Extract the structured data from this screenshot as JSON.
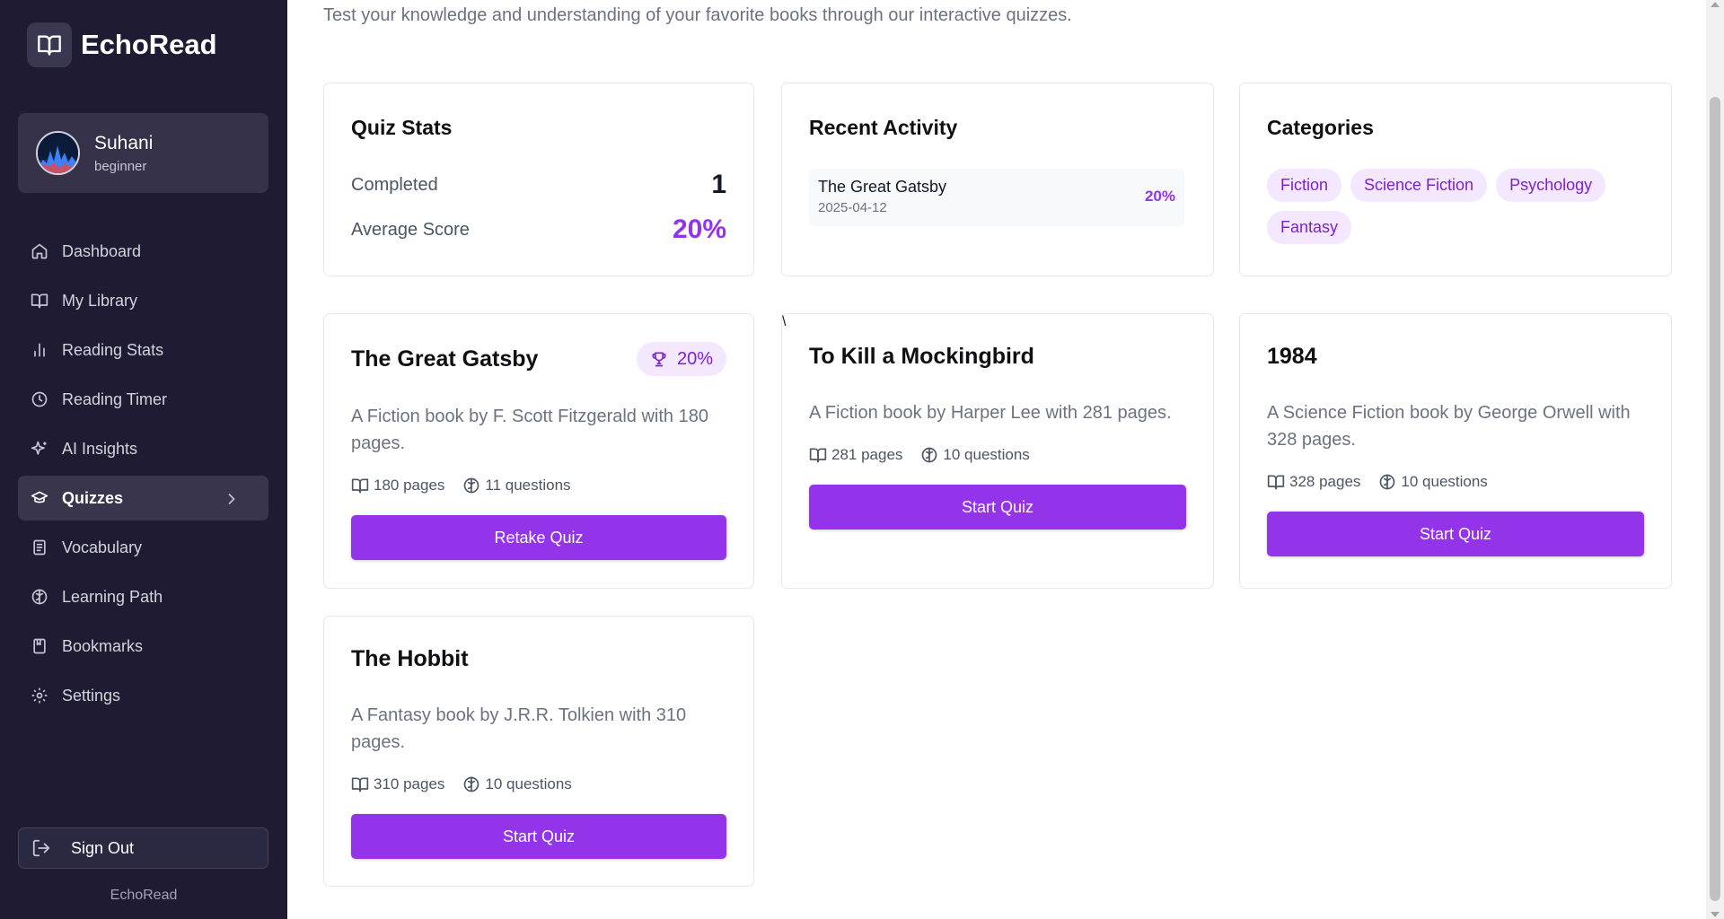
{
  "app": {
    "name": "EchoRead",
    "footer": "EchoRead"
  },
  "user": {
    "name": "Suhani",
    "level": "beginner"
  },
  "nav": [
    {
      "label": "Dashboard",
      "icon": "home-icon"
    },
    {
      "label": "My Library",
      "icon": "book-open-icon"
    },
    {
      "label": "Reading Stats",
      "icon": "bar-chart-icon"
    },
    {
      "label": "Reading Timer",
      "icon": "clock-icon"
    },
    {
      "label": "AI Insights",
      "icon": "sparkles-icon"
    },
    {
      "label": "Quizzes",
      "icon": "graduation-cap-icon",
      "active": true
    },
    {
      "label": "Vocabulary",
      "icon": "notebook-icon"
    },
    {
      "label": "Learning Path",
      "icon": "brain-icon"
    },
    {
      "label": "Bookmarks",
      "icon": "bookmark-book-icon"
    },
    {
      "label": "Settings",
      "icon": "gear-icon"
    }
  ],
  "sign_out": "Sign Out",
  "page": {
    "subtitle": "Test your knowledge and understanding of your favorite books through our interactive quizzes."
  },
  "quiz_stats": {
    "title": "Quiz Stats",
    "completed_label": "Completed",
    "completed_value": "1",
    "average_label": "Average Score",
    "average_value": "20%"
  },
  "recent_activity": {
    "title": "Recent Activity",
    "items": [
      {
        "book": "The Great Gatsby",
        "date": "2025-04-12",
        "score": "20%"
      }
    ]
  },
  "categories": {
    "title": "Categories",
    "tags": [
      "Fiction",
      "Science Fiction",
      "Psychology",
      "Fantasy"
    ]
  },
  "books": [
    {
      "title": "The Great Gatsby",
      "score": "20%",
      "description": "A Fiction book by F. Scott Fitzgerald with 180 pages.",
      "pages": "180 pages",
      "questions": "11 questions",
      "button": "Retake Quiz"
    },
    {
      "title": "To Kill a Mockingbird",
      "description": "A Fiction book by Harper Lee with 281 pages.",
      "pages": "281 pages",
      "questions": "10 questions",
      "button": "Start Quiz"
    },
    {
      "title": "1984",
      "description": "A Science Fiction book by George Orwell with 328 pages.",
      "pages": "328 pages",
      "questions": "10 questions",
      "button": "Start Quiz"
    },
    {
      "title": "The Hobbit",
      "description": "A Fantasy book by J.R.R. Tolkien with 310 pages.",
      "pages": "310 pages",
      "questions": "10 questions",
      "button": "Start Quiz"
    }
  ],
  "colors": {
    "sidebar": "#1e1b33",
    "accent": "#9333ea",
    "tag_bg": "#f3e8ff",
    "tag_text": "#7e22ce"
  }
}
